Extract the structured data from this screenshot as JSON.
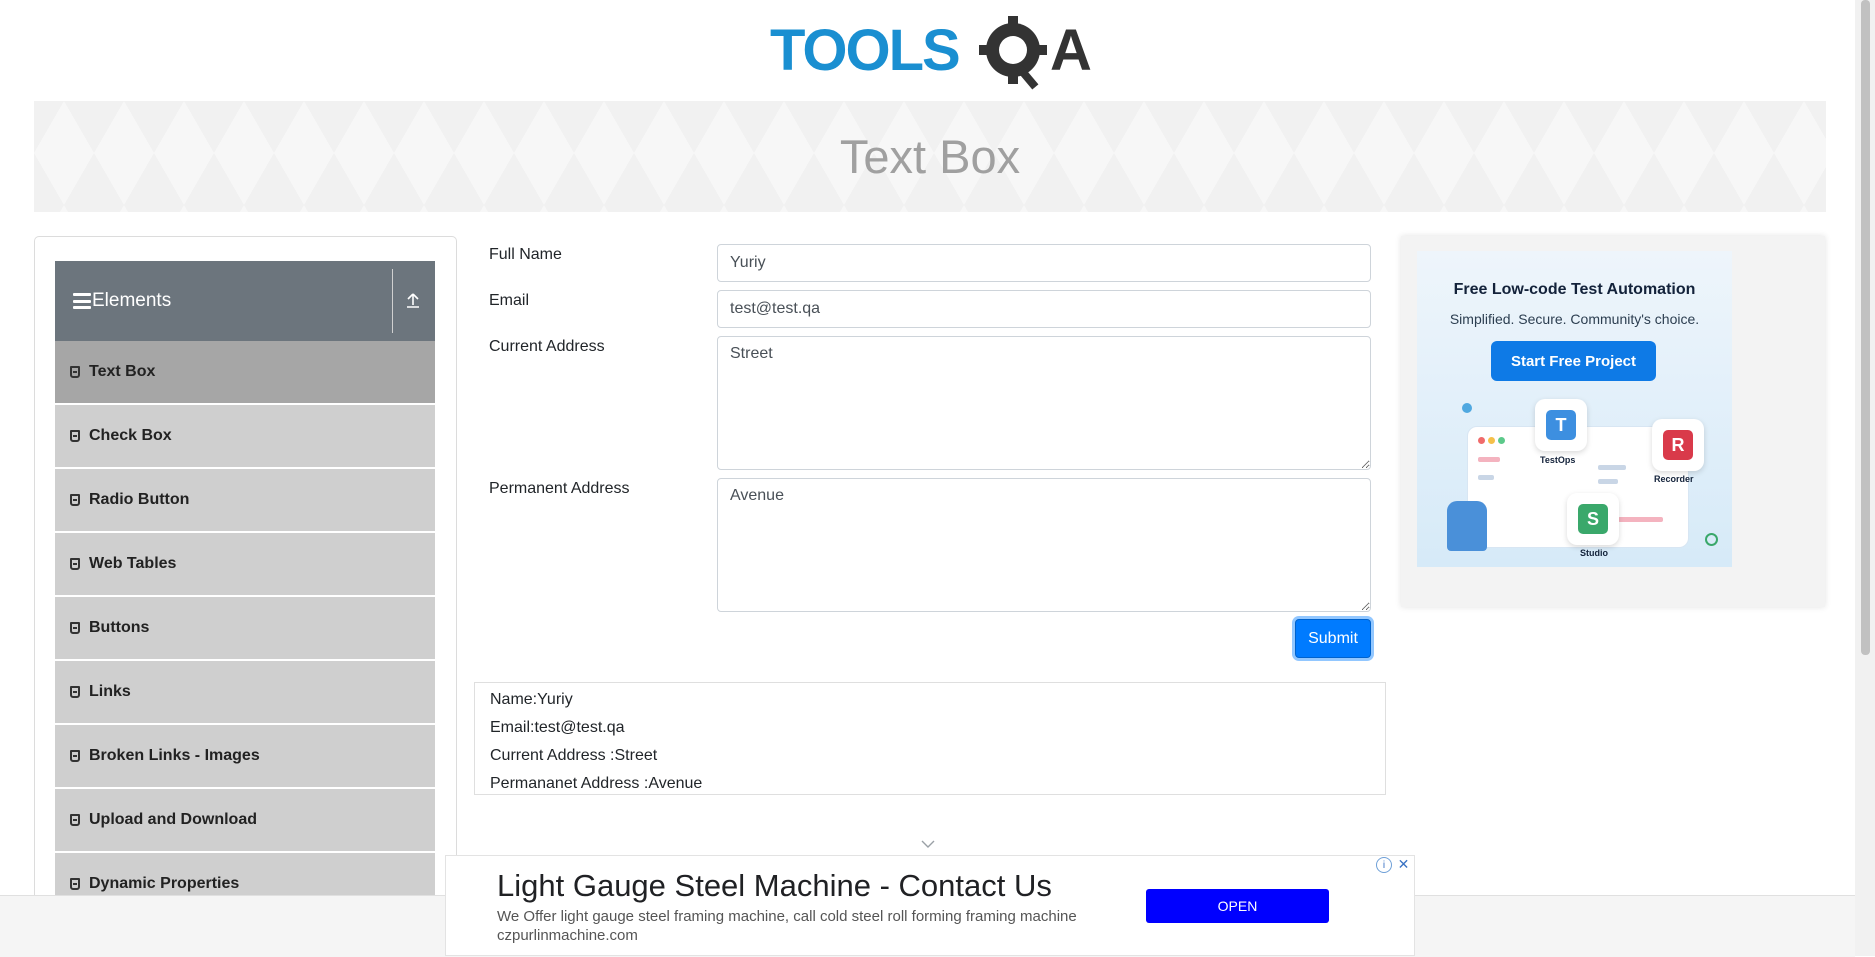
{
  "brand": {
    "logo_text": "TOOLSQA"
  },
  "page": {
    "title": "Text Box"
  },
  "sidebar": {
    "group_title": "Elements",
    "items": [
      {
        "label": "Text Box",
        "active": true
      },
      {
        "label": "Check Box"
      },
      {
        "label": "Radio Button"
      },
      {
        "label": "Web Tables"
      },
      {
        "label": "Buttons"
      },
      {
        "label": "Links"
      },
      {
        "label": "Broken Links - Images"
      },
      {
        "label": "Upload and Download"
      },
      {
        "label": "Dynamic Properties"
      }
    ]
  },
  "form": {
    "full_name_label": "Full Name",
    "full_name_value": "Yuriy",
    "email_label": "Email",
    "email_value": "test@test.qa",
    "current_address_label": "Current Address",
    "current_address_value": "Street",
    "permanent_address_label": "Permanent Address",
    "permanent_address_value": "Avenue",
    "submit_label": "Submit"
  },
  "output": {
    "name": "Name:Yuriy",
    "email": "Email:test@test.qa",
    "current_address": "Current Address :Street",
    "permanent_address": "Permananet Address :Avenue"
  },
  "side_ad": {
    "title": "Free Low-code Test Automation",
    "subtitle": "Simplified. Secure. Community's choice.",
    "button": "Start Free Project",
    "tile_testops": "TestOps",
    "tile_recorder": "Recorder",
    "tile_studio": "Studio"
  },
  "bottom_ad": {
    "headline": "Light Gauge Steel Machine - Contact Us",
    "description": "We Offer light gauge steel framing machine, call cold steel roll forming framing machine",
    "domain": "czpurlinmachine.com",
    "button": "OPEN"
  },
  "colors": {
    "primary": "#007bff",
    "sidebar_header": "#6c757d",
    "logo_blue": "#1a8fd1",
    "logo_dark": "#333333"
  }
}
